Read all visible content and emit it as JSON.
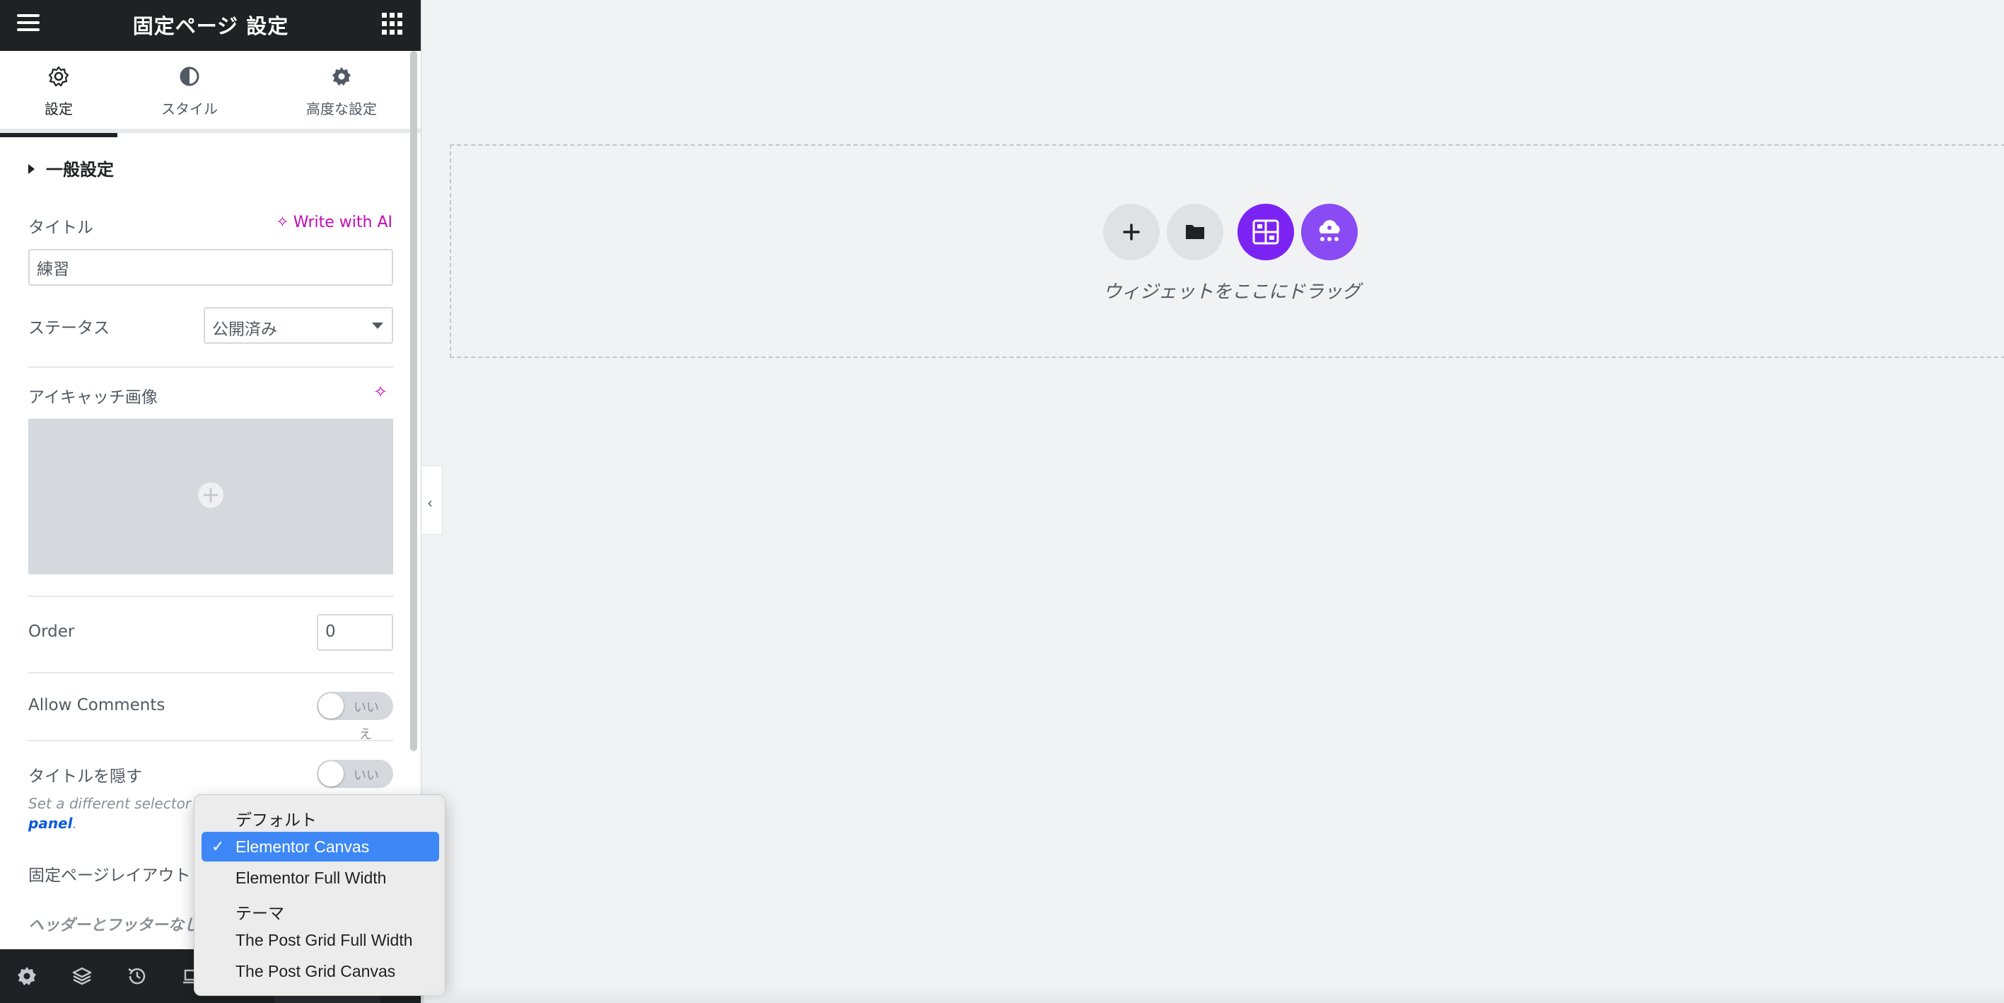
{
  "header": {
    "title": "固定ページ 設定"
  },
  "tabs": [
    {
      "label": "設定",
      "active": true
    },
    {
      "label": "スタイル",
      "active": false
    },
    {
      "label": "高度な設定",
      "active": false
    }
  ],
  "section": {
    "title": "一般設定"
  },
  "fields": {
    "title_label": "タイトル",
    "write_with_ai": "Write with AI",
    "title_value": "練習",
    "status_label": "ステータス",
    "status_value": "公開済み",
    "featured_image_label": "アイキャッチ画像",
    "order_label": "Order",
    "order_value": "0",
    "allow_comments_label": "Allow Comments",
    "allow_comments_toggle": "いい",
    "allow_comments_toggle_wrap": "え",
    "hide_title_label": "タイトルを隠す",
    "hide_title_toggle": "いい",
    "help_text": "Set a different selector f",
    "help_link": "panel",
    "help_period": ".",
    "page_layout_label": "固定ページレイアウト",
    "layout_hint": "ヘッダーとフッターなし"
  },
  "dropdown": {
    "options": [
      {
        "label": "デフォルト",
        "selected": false
      },
      {
        "label": "Elementor Canvas",
        "selected": true
      },
      {
        "label": "Elementor Full Width",
        "selected": false
      },
      {
        "label": "テーマ",
        "selected": false
      },
      {
        "label": "The Post Grid Full Width",
        "selected": false
      },
      {
        "label": "The Post Grid Canvas",
        "selected": false
      }
    ],
    "check_glyph": "✓"
  },
  "canvas": {
    "drop_text": "ウィジェットをここにドラッグ"
  },
  "colors": {
    "accent_ai": "#c00bb8",
    "selection": "#3d88f6",
    "link": "#0c5adb",
    "topbar": "#1f2124"
  },
  "icons": {
    "menu": "hamburger-icon",
    "apps": "grid-icon",
    "settings_tab": "gear-outline-icon",
    "style_tab": "half-circle-icon",
    "advanced_tab": "gear-icon",
    "collapse": "chevron-left-icon",
    "add": "plus-icon",
    "template": "folder-icon",
    "kit": "layout-icon",
    "ai_builder": "cloud-robot-icon"
  }
}
